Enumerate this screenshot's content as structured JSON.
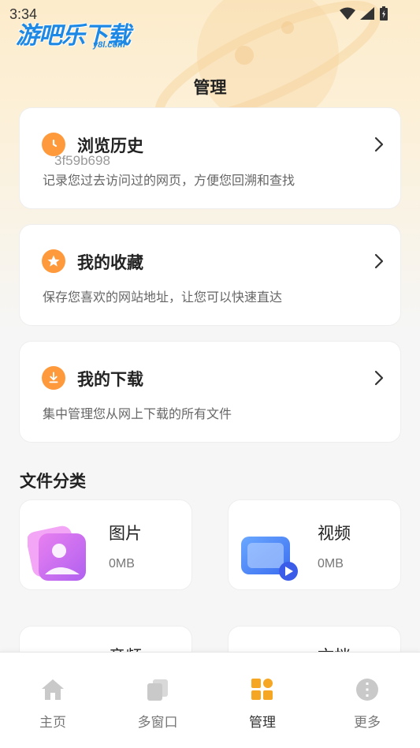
{
  "status": {
    "time": "3:34"
  },
  "brand": {
    "logo": "游吧乐下载",
    "domain": "y8l.com"
  },
  "page_title": "管理",
  "watermark": "3f59b698",
  "cards": [
    {
      "title": "浏览历史",
      "desc": "记录您过去访问过的网页，方便您回溯和查找",
      "icon": "clock-icon"
    },
    {
      "title": "我的收藏",
      "desc": "保存您喜欢的网站地址，让您可以快速直达",
      "icon": "star-icon"
    },
    {
      "title": "我的下载",
      "desc": "集中管理您从网上下载的所有文件",
      "icon": "download-icon"
    }
  ],
  "section": {
    "title": "文件分类"
  },
  "categories": [
    {
      "name": "图片",
      "size": "0MB",
      "icon": "image-folder-icon"
    },
    {
      "name": "视频",
      "size": "0MB",
      "icon": "video-folder-icon"
    },
    {
      "name": "音频"
    },
    {
      "name": "文档"
    }
  ],
  "nav": [
    {
      "label": "主页",
      "icon": "home-icon"
    },
    {
      "label": "多窗口",
      "icon": "windows-icon"
    },
    {
      "label": "管理",
      "icon": "manage-icon",
      "active": true
    },
    {
      "label": "更多",
      "icon": "more-icon"
    }
  ],
  "colors": {
    "accent": "#ff9a3c",
    "active_nav": "#f5a623",
    "inactive_nav": "#c9c9c9"
  }
}
